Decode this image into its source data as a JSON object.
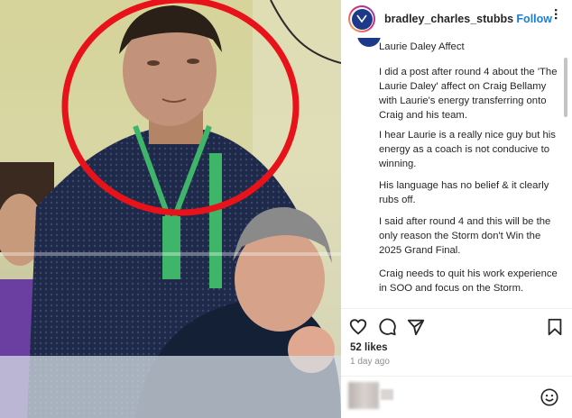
{
  "post": {
    "username": "bradley_charles_stubbs",
    "follow_label": "Follow",
    "more_label": "...",
    "likes": "52 likes",
    "time": "1 day ago"
  },
  "caption": {
    "paragraphs": [
      "Laurie Daley Affect",
      "I did a post after round 4 about the 'The Laurie Daley' affect on Craig Bellamy with Laurie's energy transferring onto Craig and his team.",
      "I hear Laurie is a really nice guy but his energy as a coach is not conducive to winning.",
      "His language has no belief & it clearly rubs off.",
      "I said after round 4 and this will be the only reason the Storm don't Win the 2025 Grand Final.",
      "Craig needs to quit his work experience in SOO and focus on the Storm."
    ]
  },
  "icons": {
    "like": "heart-icon",
    "comment": "comment-icon",
    "share": "send-icon",
    "save": "bookmark-icon",
    "emoji": "smiley-icon",
    "avatar": "profile-avatar"
  },
  "colors": {
    "accent": "#1a7fd8",
    "text": "#262626",
    "muted": "#8e8e8e",
    "circle": "#e8121a"
  }
}
